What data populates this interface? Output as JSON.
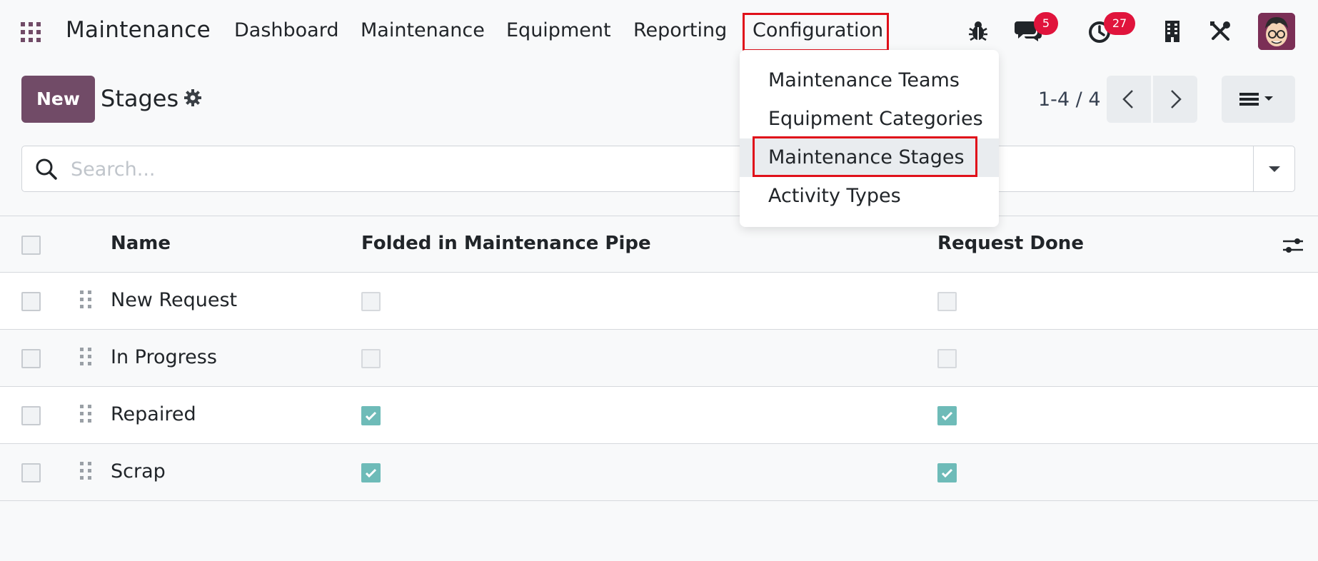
{
  "navbar": {
    "app_name": "Maintenance",
    "menu": [
      {
        "label": "Dashboard"
      },
      {
        "label": "Maintenance"
      },
      {
        "label": "Equipment"
      },
      {
        "label": "Reporting"
      },
      {
        "label": "Configuration"
      }
    ],
    "messages_badge": "5",
    "activities_badge": "27"
  },
  "control_panel": {
    "new_label": "New",
    "breadcrumb": "Stages",
    "pager_value": "1-4 / 4"
  },
  "search": {
    "placeholder": "Search..."
  },
  "table": {
    "headers": {
      "name": "Name",
      "folded": "Folded in Maintenance Pipe",
      "done": "Request Done"
    },
    "rows": [
      {
        "name": "New Request",
        "folded": false,
        "done": false
      },
      {
        "name": "In Progress",
        "folded": false,
        "done": false
      },
      {
        "name": "Repaired",
        "folded": true,
        "done": true
      },
      {
        "name": "Scrap",
        "folded": true,
        "done": true
      }
    ]
  },
  "dropdown": {
    "items": [
      {
        "label": "Maintenance Teams"
      },
      {
        "label": "Equipment Categories"
      },
      {
        "label": "Maintenance Stages"
      },
      {
        "label": "Activity Types"
      }
    ]
  },
  "colors": {
    "brand": "#714b67",
    "check_on": "#6ebbb8",
    "badge": "#e0143c",
    "highlight": "#e0101a"
  }
}
